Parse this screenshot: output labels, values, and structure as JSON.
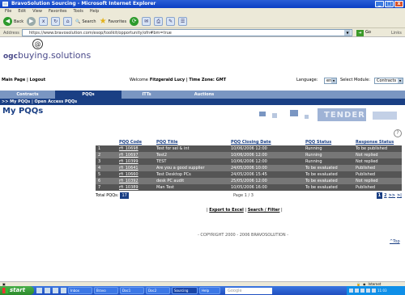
{
  "window": {
    "title": "BravoSolution Sourcing - Microsoft Internet Explorer",
    "minimize": "_",
    "maximize": "□",
    "close": "x"
  },
  "menubar": [
    "File",
    "Edit",
    "View",
    "Favorites",
    "Tools",
    "Help"
  ],
  "toolbar": {
    "back_label": "Back",
    "search_label": "Search",
    "favorites_label": "Favorites"
  },
  "address": {
    "label": "Address",
    "url": "https://www.bravosolution.com/esop/toolkit/opportunity/ofn#bm=true",
    "go_label": "Go",
    "links_label": "Links"
  },
  "logo": {
    "prefix": "ogc",
    "name": "buying.solutions"
  },
  "topnav": {
    "home": "Main Page | Logout",
    "welcome_label": "Welcome",
    "user": "Fitzgerald Lucy | Time Zone: GMT",
    "language_label": "Language:",
    "language_value": "en",
    "select_module_label": "Select Module:",
    "select_module_value": "Contracts"
  },
  "tabs": [
    "Contracts",
    "PQQs",
    "ITTs",
    "Auctions"
  ],
  "subnav": ">> My PQQs | Open Access PQQs",
  "page_title": "My PQQs",
  "banner_word": "TENDER",
  "table": {
    "headers": [
      "",
      "PQQ Code",
      "PQQ Title",
      "PQQ Closing Date",
      "PQQ Status",
      "Response Status"
    ],
    "rows": [
      [
        "1",
        "rfi_10698",
        "Test for sel & int",
        "10/06/2006 12:00",
        "Running",
        "To be published"
      ],
      [
        "2",
        "rfi_10697",
        "Test2",
        "10/06/2006 12:00",
        "Running",
        "Not replied"
      ],
      [
        "3",
        "rfi_10399",
        "TEST",
        "10/06/2006 12:00",
        "Running",
        "Not replied"
      ],
      [
        "4",
        "rfi_10641",
        "Are you a good supplier",
        "24/05/2006 10:00",
        "To be evaluated",
        "Published"
      ],
      [
        "5",
        "rfi_10660",
        "Test Desktop PCs",
        "24/05/2006 15:45",
        "To be evaluated",
        "Published"
      ],
      [
        "6",
        "rfi_10392",
        "desk PC audit",
        "25/05/2006 12:00",
        "To be evaluated",
        "Not replied"
      ],
      [
        "7",
        "rfi_10389",
        "Man Test",
        "10/05/2006 16:00",
        "To be evaluated",
        "Published"
      ]
    ]
  },
  "totals": {
    "label": "Total PQQs:",
    "count": "17",
    "page_info": "Page 1 / 3"
  },
  "pager": {
    "current": "1",
    "page2": "2",
    "next": ">>",
    "last": ">|"
  },
  "links": {
    "export": "Export to Excel",
    "search": "Search / Filter",
    "sep": "|"
  },
  "copyright": "- COPYRIGHT 2000 - 2006 BRAVOSOLUTION -",
  "totop": "^Top",
  "status": {
    "zone": "Internet"
  },
  "taskbar": {
    "start": "start",
    "buttons": [
      "Inbox",
      "Bravo",
      "Doc1",
      "Doc2",
      "Sourcing",
      "Help"
    ],
    "search_placeholder": "Google",
    "clock": "11:03"
  }
}
